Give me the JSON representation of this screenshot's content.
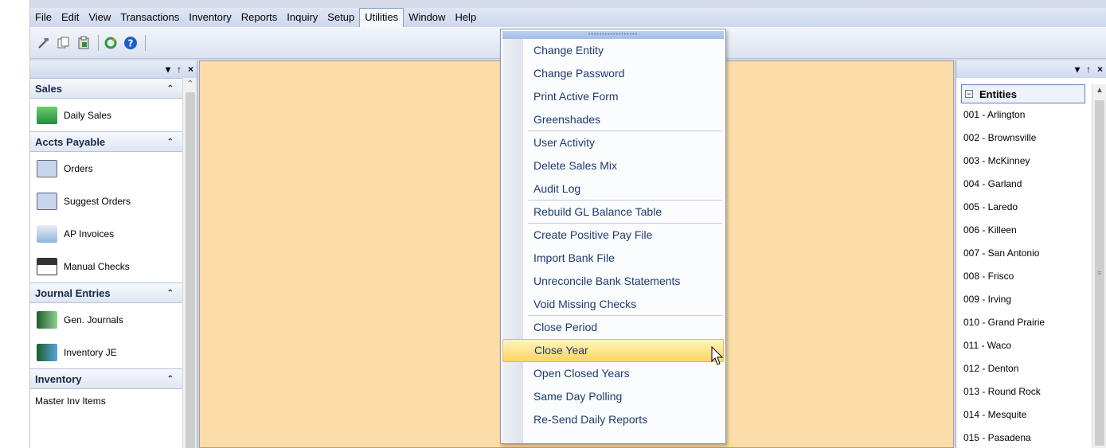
{
  "menubar": {
    "items": [
      "File",
      "Edit",
      "View",
      "Transactions",
      "Inventory",
      "Reports",
      "Inquiry",
      "Setup",
      "Utilities",
      "Window",
      "Help"
    ],
    "active": "Utilities"
  },
  "toolbar": {
    "icons": [
      "hammer-icon",
      "copy-icon",
      "paste-icon",
      "refresh-icon",
      "help-icon"
    ]
  },
  "left_panel": {
    "caption_controls": [
      "▾",
      "↑",
      "×"
    ],
    "groups": [
      {
        "title": "Sales",
        "items": [
          "Daily Sales"
        ]
      },
      {
        "title": "Accts Payable",
        "items": [
          "Orders",
          "Suggest Orders",
          "AP Invoices",
          "Manual Checks"
        ]
      },
      {
        "title": "Journal Entries",
        "items": [
          "Gen. Journals",
          "Inventory JE"
        ]
      },
      {
        "title": "Inventory",
        "items": [
          "Master Inv Items"
        ]
      }
    ]
  },
  "right_panel": {
    "caption_controls": [
      "▾",
      "↑",
      "×"
    ],
    "root_label": "Entities",
    "entities": [
      "001 - Arlington",
      "002 - Brownsville",
      "003 - McKinney",
      "004 - Garland",
      "005 - Laredo",
      "006 - Killeen",
      "007 - San Antonio",
      "008 - Frisco",
      "009 - Irving",
      "010 - Grand Prairie",
      "011 - Waco",
      "012 - Denton",
      "013 - Round Rock",
      "014 - Mesquite",
      "015 - Pasadena"
    ]
  },
  "utilities_menu": {
    "items": [
      "Change Entity",
      "Change Password",
      "Print Active Form",
      "Greenshades",
      "User Activity",
      "Delete Sales Mix",
      "Audit Log",
      "Rebuild GL Balance Table",
      "Create Positive Pay File",
      "Import Bank File",
      "Unreconcile Bank Statements",
      "Void Missing Checks",
      "Close Period",
      "Close Year",
      "Open Closed Years",
      "Same Day Polling",
      "Re-Send Daily Reports"
    ],
    "separators_after": [
      3,
      6,
      7,
      11
    ],
    "highlighted": "Close Year"
  },
  "colors": {
    "canvas": "#fcdca8",
    "menu_highlight": "#fcd660",
    "menu_text": "#1e3a6e"
  }
}
